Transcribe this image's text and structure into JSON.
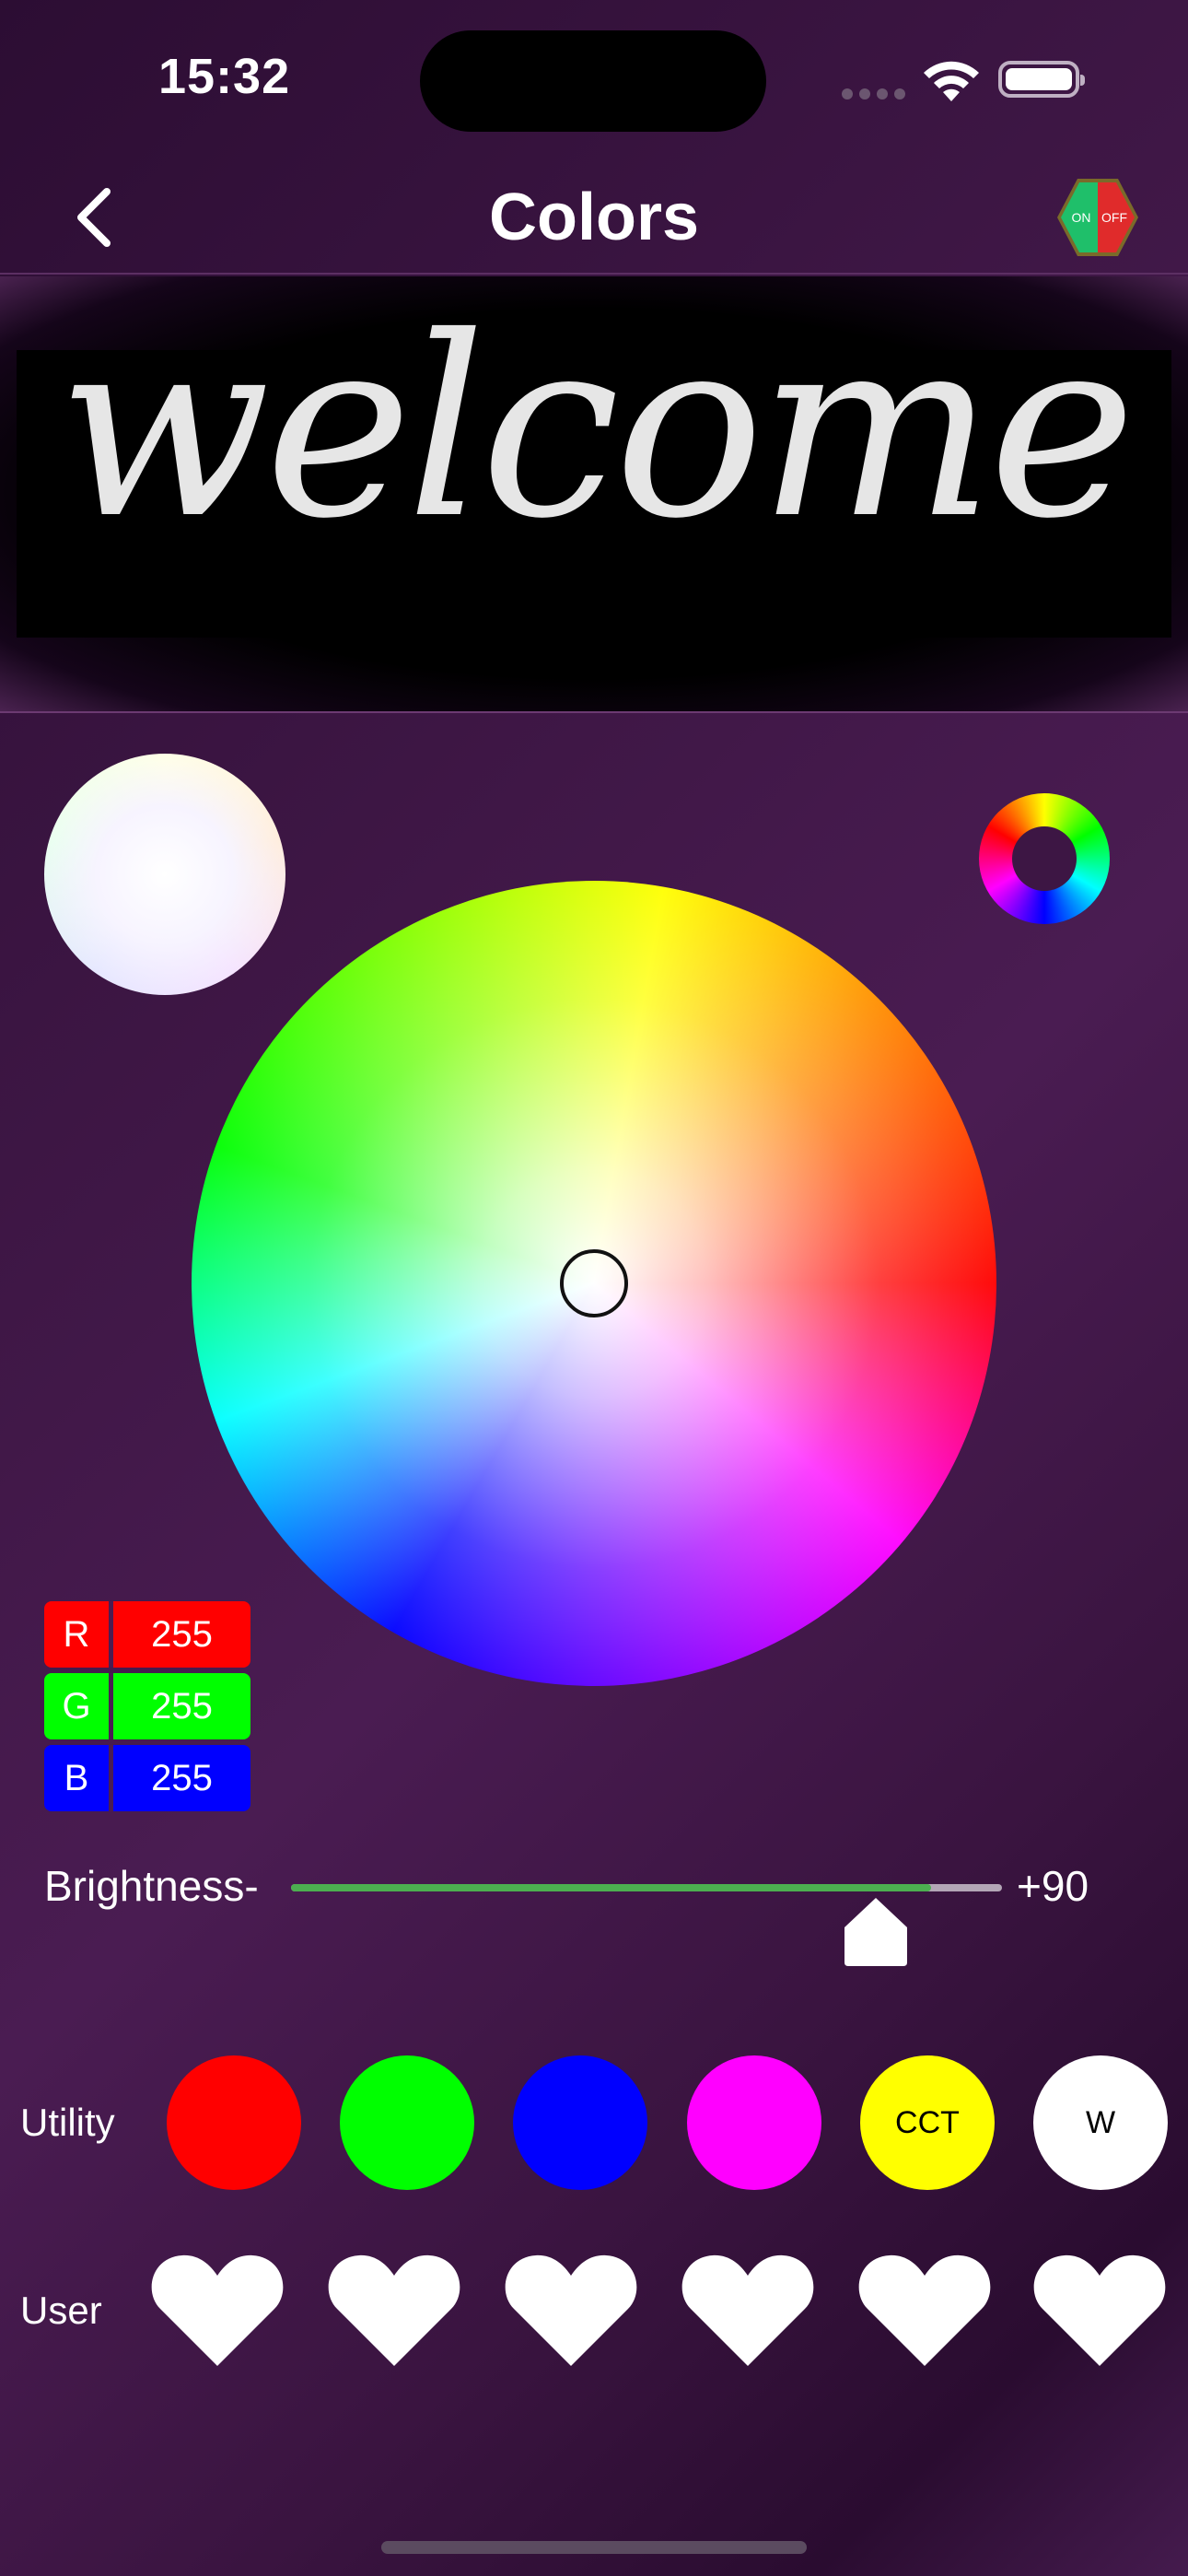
{
  "status_bar": {
    "time": "15:32"
  },
  "nav": {
    "title": "Colors",
    "power": {
      "on_label": "ON",
      "off_label": "OFF"
    }
  },
  "preview": {
    "text": "welcome"
  },
  "rgb": [
    {
      "key": "R",
      "value": "255",
      "color": "#ff0000"
    },
    {
      "key": "G",
      "value": "255",
      "color": "#00ff00"
    },
    {
      "key": "B",
      "value": "255",
      "color": "#0000ff"
    }
  ],
  "brightness": {
    "label": "Brightness-",
    "value_label": "+90",
    "fraction": 0.9,
    "fill_color": "#4caf50"
  },
  "utility": {
    "label": "Utility",
    "buttons": [
      {
        "name": "red",
        "label": "",
        "color": "#ff0000"
      },
      {
        "name": "green",
        "label": "",
        "color": "#00ff00"
      },
      {
        "name": "blue",
        "label": "",
        "color": "#0000ff"
      },
      {
        "name": "magenta",
        "label": "",
        "color": "#ff00ff"
      },
      {
        "name": "cct",
        "label": "CCT",
        "color": "#ffff00"
      },
      {
        "name": "white",
        "label": "W",
        "color": "#ffffff"
      }
    ]
  },
  "user": {
    "label": "User",
    "slots": 6,
    "icon": "heart-icon"
  }
}
